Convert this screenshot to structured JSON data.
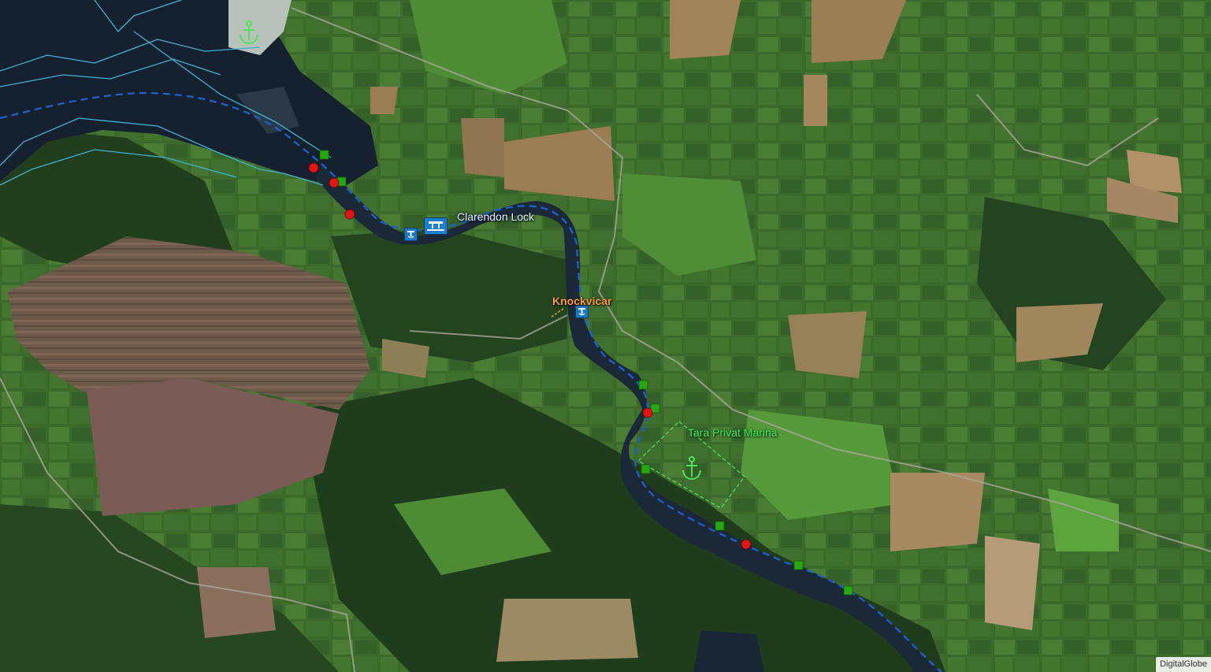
{
  "map": {
    "basemap": "satellite-imagery",
    "attribution": "DigitalGlobe",
    "route_color": "#1d5fc9",
    "waterway_outline_color": "#3fb3d6",
    "marker_colors": {
      "green": "#27a812",
      "red": "#e01616"
    }
  },
  "labels": {
    "lock": "Clarendon Lock",
    "village": "Knockvicar",
    "marina": "Tara Privat Marina"
  },
  "icons": {
    "marina_top": "anchor-icon",
    "marina_center": "anchor-icon",
    "lock": "lock-gate-icon",
    "harbour": "mooring-icon"
  }
}
